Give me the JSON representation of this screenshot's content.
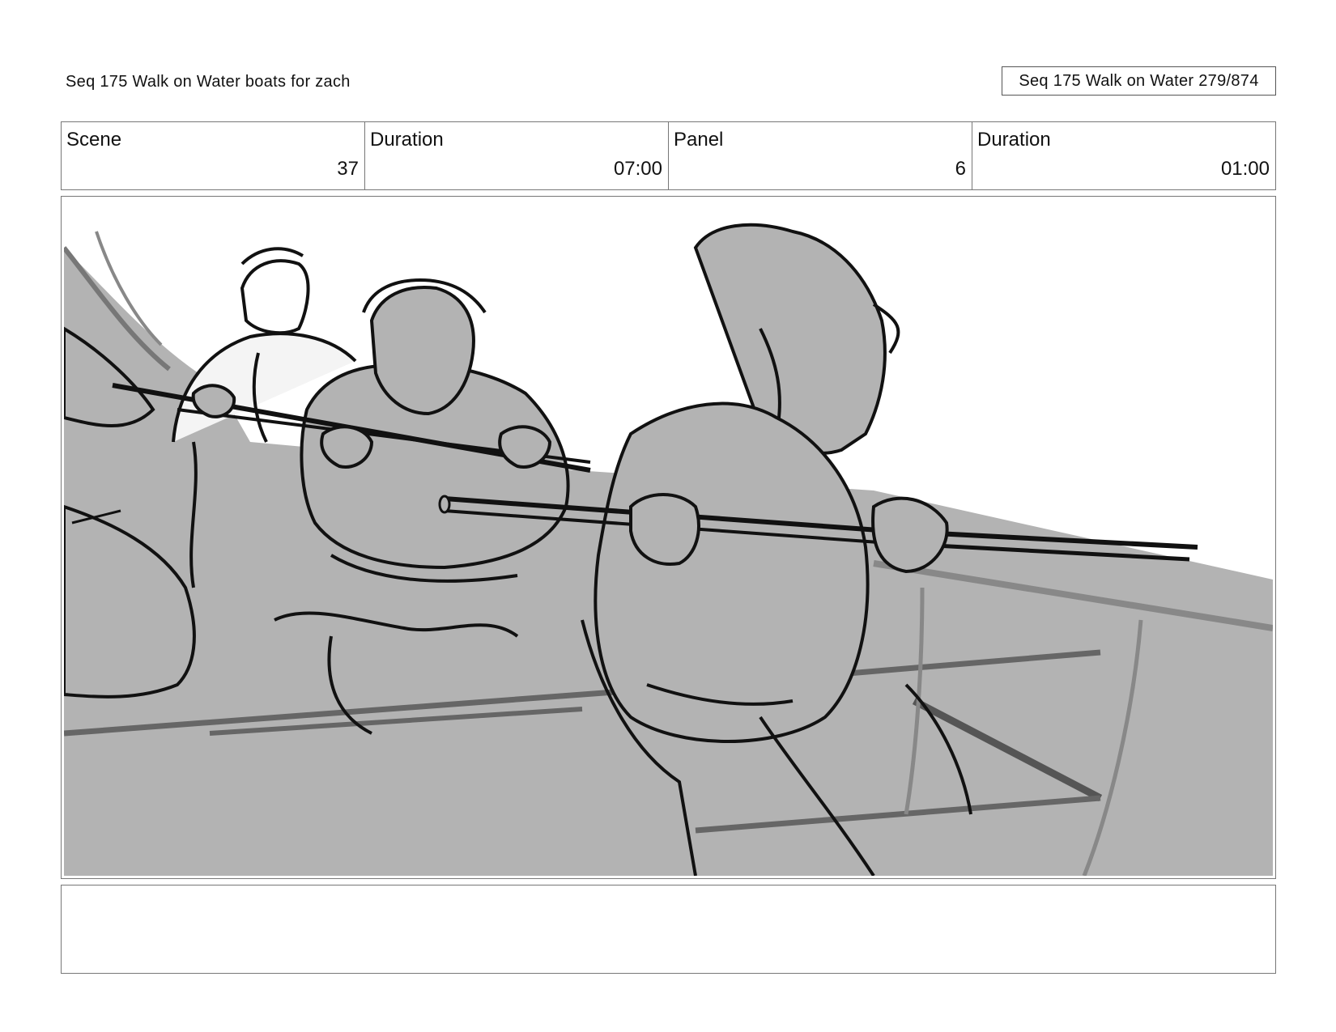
{
  "header": {
    "project_title": "Seq 175 Walk on Water  boats for zach",
    "page_indicator": "Seq 175 Walk on Water 279/874"
  },
  "info": {
    "scene_label": "Scene",
    "scene_value": "37",
    "scene_duration_label": "Duration",
    "scene_duration_value": "07:00",
    "panel_label": "Panel",
    "panel_value": "6",
    "panel_duration_label": "Duration",
    "panel_duration_value": "01:00"
  },
  "notes": {
    "text": ""
  }
}
